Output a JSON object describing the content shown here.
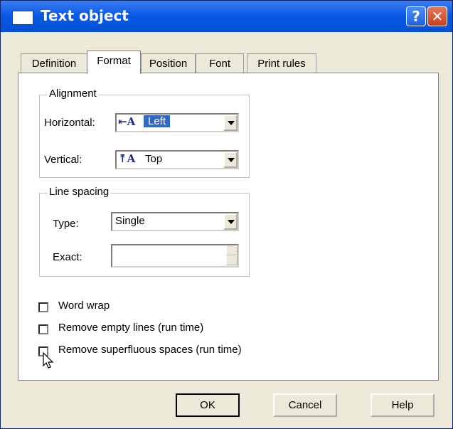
{
  "window": {
    "title": "Text object",
    "help_glyph": "?",
    "close_glyph": "✕"
  },
  "tabs": [
    {
      "label": "Definition",
      "active": false
    },
    {
      "label": "Format",
      "active": true
    },
    {
      "label": "Position",
      "active": false
    },
    {
      "label": "Font",
      "active": false
    },
    {
      "label": "Print rules",
      "active": false
    }
  ],
  "alignment": {
    "legend": "Alignment",
    "horizontal_label": "Horizontal:",
    "horizontal_value": "Left",
    "horizontal_icon": "align-left-icon",
    "vertical_label": "Vertical:",
    "vertical_value": "Top",
    "vertical_icon": "align-top-icon"
  },
  "line_spacing": {
    "legend": "Line spacing",
    "type_label": "Type:",
    "type_value": "Single",
    "exact_label": "Exact:",
    "exact_value": ""
  },
  "options": {
    "word_wrap": {
      "label": "Word wrap",
      "checked": false
    },
    "remove_empty_lines": {
      "label": "Remove empty lines (run time)",
      "checked": false
    },
    "remove_spaces": {
      "label": "Remove superfluous spaces (run time)",
      "checked": false
    }
  },
  "buttons": {
    "ok": "OK",
    "cancel": "Cancel",
    "help": "Help"
  },
  "colors": {
    "title_bar": "#0a5ae6",
    "selection": "#316ac5",
    "dialog_bg": "#ece9d8"
  }
}
